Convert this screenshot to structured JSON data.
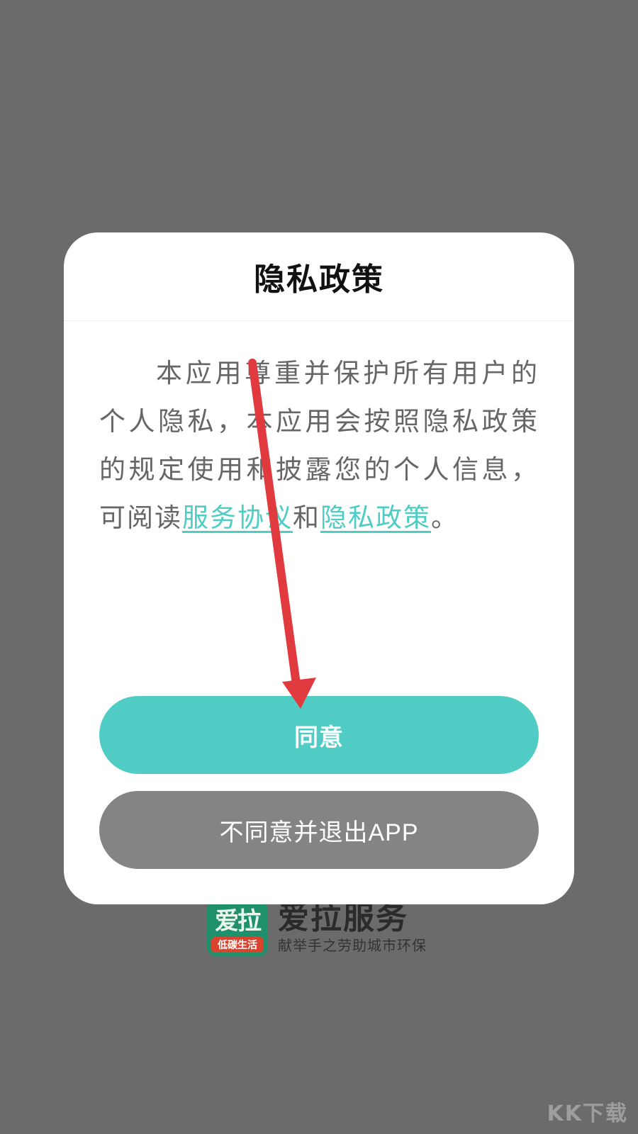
{
  "dialog": {
    "title": "隐私政策",
    "body_intro": "本应用尊重并保护所有用户的个人隐私，本应用会按照隐私政策的规定使用和披露您的个人信息，可阅读",
    "link_service": "服务协议",
    "conjunction": "和",
    "link_privacy": "隐私政策",
    "body_end": "。",
    "agree_label": "同意",
    "decline_label": "不同意并退出APP"
  },
  "brand": {
    "logo_top": "爱拉",
    "logo_bottom": "低碳生活",
    "name": "爱拉服务",
    "slogan": "献举手之劳助城市环保"
  },
  "watermark": "KK下载",
  "colors": {
    "accent": "#50ccc4",
    "link": "#4ecdc4",
    "decline": "#848484",
    "overlay": "#6b6b6b",
    "annotation": "#e0393e"
  },
  "annotation": {
    "type": "arrow",
    "points_to": "agree-button"
  }
}
